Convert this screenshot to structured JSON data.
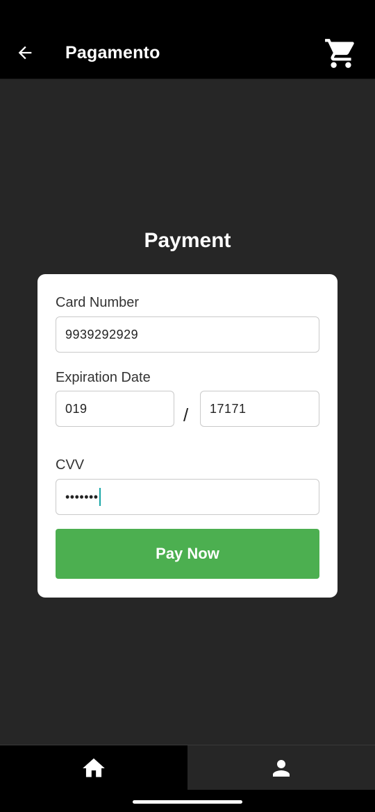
{
  "appbar": {
    "title": "Pagamento",
    "back_icon": "arrow-back-icon",
    "cart_icon": "shopping-cart-icon"
  },
  "main": {
    "title": "Payment",
    "card_number": {
      "label": "Card Number",
      "value": "9939292929"
    },
    "expiration": {
      "label": "Expiration Date",
      "month": "019",
      "separator": "/",
      "year": "17171"
    },
    "cvv": {
      "label": "CVV",
      "value": "•••••••"
    },
    "pay_button": "Pay Now"
  },
  "bottom_nav": {
    "items": [
      {
        "icon": "home-icon",
        "selected": true
      },
      {
        "icon": "person-icon",
        "selected": false
      }
    ]
  },
  "colors": {
    "background": "#262626",
    "appbar": "#000000",
    "card": "#ffffff",
    "accent": "#4caf50",
    "caret": "#16a6a6"
  }
}
